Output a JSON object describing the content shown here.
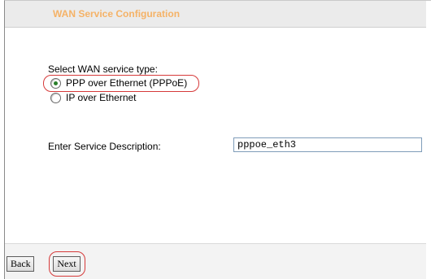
{
  "header": {
    "title": "WAN Service Configuration"
  },
  "service_type": {
    "prompt": "Select WAN service type:",
    "options": [
      {
        "label": "PPP over Ethernet (PPPoE)",
        "selected": true
      },
      {
        "label": "IP over Ethernet",
        "selected": false
      }
    ]
  },
  "description": {
    "label": "Enter Service Description:",
    "value": "pppoe_eth3"
  },
  "buttons": {
    "back_label": "Back",
    "next_label": "Next"
  },
  "colors": {
    "header_title": "#f5b266",
    "header_bg": "#ebebeb",
    "annotation_red": "#d63a3a"
  }
}
